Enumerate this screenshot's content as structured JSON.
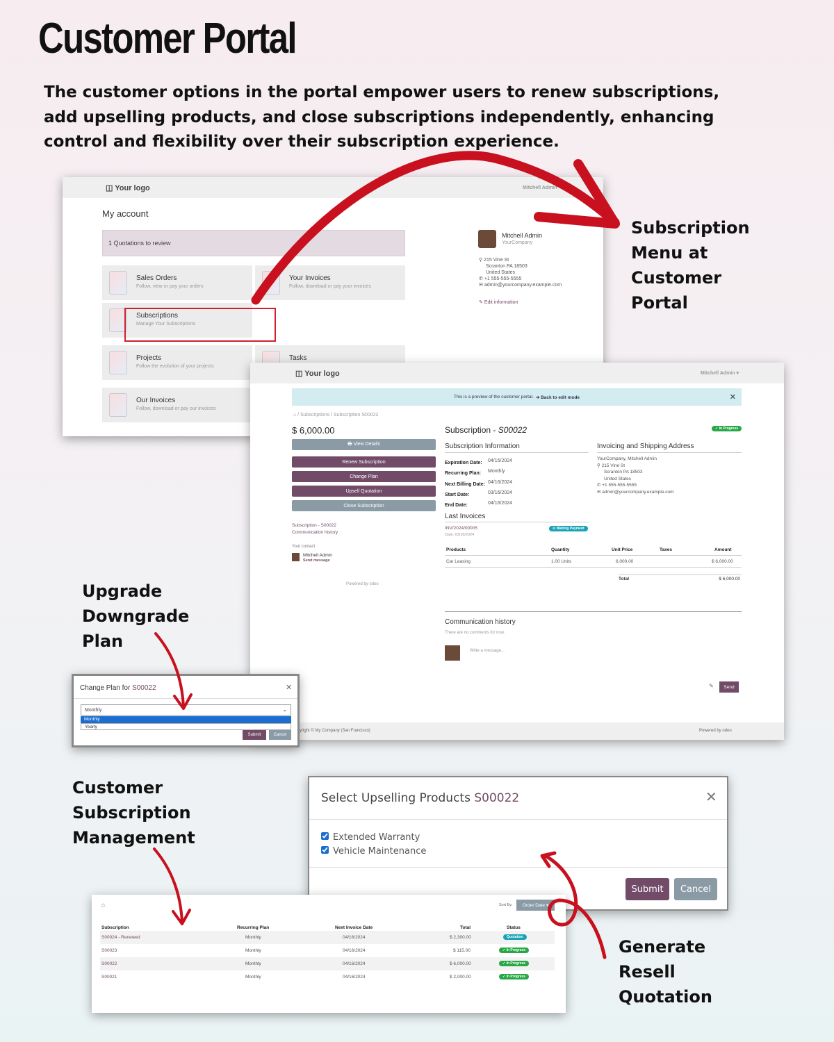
{
  "title": "Customer Portal",
  "intro": "The customer options in the portal empower users to renew subscriptions, add upselling products, and close subscriptions independently, enhancing control and flexibility over their subscription experience.",
  "callouts": {
    "menu": [
      "Subscription",
      "Menu at",
      "Customer",
      "Portal"
    ],
    "plan": [
      "Upgrade",
      "Downgrade",
      "Plan"
    ],
    "management": [
      "Customer",
      "Subscription",
      "Management"
    ],
    "resell": [
      "Generate",
      "Resell",
      "Quotation"
    ]
  },
  "colors": {
    "arrow": "#c8101e",
    "brand_purple": "#714b67",
    "badge_green": "#28a745",
    "badge_blue": "#17a2b8"
  },
  "myaccount": {
    "logo": "Your logo",
    "user_menu": "Mitchell Admin",
    "heading": "My account",
    "alert": "1 Quotations to review",
    "tiles": [
      {
        "title": "Sales Orders",
        "sub": "Follow, view or pay your orders"
      },
      {
        "title": "Your Invoices",
        "sub": "Follow, download or pay your invoices"
      },
      {
        "title": "Subscriptions",
        "sub": "Manage Your Subscriptions"
      },
      {
        "title": "Projects",
        "sub": "Follow the evolution of your projects"
      },
      {
        "title": "Tasks",
        "sub": ""
      },
      {
        "title": "Our Invoices",
        "sub": "Follow, download or pay our invoices"
      }
    ],
    "contact": {
      "name": "Mitchell Admin",
      "company": "YourCompany",
      "address1": "215 Vine St",
      "address2": "Scranton PA 18503",
      "address3": "United States",
      "phone": "+1 555-555-5555",
      "email": "admin@yourcompany.example.com",
      "edit": "Edit information"
    }
  },
  "subscription": {
    "logo": "Your logo",
    "user_menu": "Mitchell Admin ▾",
    "preview": "This is a preview of the customer portal.",
    "back_link": "➔ Back to edit mode",
    "breadcrumb": "⌂  /  Subscriptions  /  Subscription S00022",
    "amount": "$ 6,000.00",
    "buttons": {
      "view": "🖶 View Details",
      "renew": "Renew Subscription",
      "change": "Change Plan",
      "upsell": "Upsell Quotation",
      "close": "Close Subscription"
    },
    "side_links": [
      "Subscription - S00022",
      "Communication history"
    ],
    "your_contact": "Your contact",
    "contact_name": "Mitchell Admin",
    "send_message": "Send message",
    "powered": "Powered by odoo",
    "heading_prefix": "Subscription - ",
    "heading_ref": "S00022",
    "status": "✓ In Progress",
    "info_title": "Subscription Information",
    "info": [
      {
        "label": "Expiration Date:",
        "value": "04/15/2024"
      },
      {
        "label": "Recurring Plan:",
        "value": "Monthly"
      },
      {
        "label": "Next Billing Date:",
        "value": "04/16/2024"
      },
      {
        "label": "Start Date:",
        "value": "03/16/2024"
      },
      {
        "label": "End Date:",
        "value": "04/16/2024"
      }
    ],
    "address_title": "Invoicing and Shipping Address",
    "address": [
      "YourCompany, Mitchell Admin",
      "215 Vine St",
      "Scranton PA 18503",
      "United States",
      "+1 555-555-5555",
      "admin@yourcompany.example.com"
    ],
    "invoices_title": "Last Invoices",
    "invoice_ref": "INV/2024/00005",
    "invoice_date": "Date: 03/16/2024",
    "invoice_status": "⊙ Waiting Payment",
    "lines_header": [
      "Products",
      "Quantity",
      "Unit Price",
      "Taxes",
      "Amount"
    ],
    "lines": [
      {
        "product": "Car Leasing",
        "qty": "1.00 Units",
        "price": "6,000.00",
        "taxes": "",
        "amount": "$ 6,000.00"
      }
    ],
    "total_label": "Total",
    "total_value": "$ 6,000.00",
    "comm_title": "Communication history",
    "no_comments": "There are no comments for now.",
    "write": "Write a message...",
    "send": "Send",
    "copyright": "Copyright © My Company (San Francisco)",
    "footer_powered": "Powered by odoo"
  },
  "change_plan": {
    "title_prefix": "Change Plan for ",
    "ref": "S00022",
    "selected": "Monthly",
    "options": [
      "Monthly",
      "Yearly"
    ],
    "submit": "Submit",
    "cancel": "Cancel"
  },
  "upsell": {
    "title_prefix": "Select Upselling Products ",
    "ref": "S00022",
    "products": [
      {
        "name": "Extended Warranty",
        "checked": true
      },
      {
        "name": "Vehicle Maintenance",
        "checked": true
      }
    ],
    "submit": "Submit",
    "cancel": "Cancel"
  },
  "sub_list": {
    "sort_by": "Sort By:",
    "sort_value": "Order Date ▾",
    "headers": [
      "Subscription",
      "Recurring Plan",
      "Next Invoice Date",
      "Total",
      "Status"
    ],
    "rows": [
      {
        "ref": "S00024 - Renewed",
        "plan": "Monthly",
        "date": "04/16/2024",
        "total": "$ 2,300.00",
        "status": "Quotation"
      },
      {
        "ref": "S00023",
        "plan": "Monthly",
        "date": "04/16/2024",
        "total": "$ 115.00",
        "status": "✓ In Progress"
      },
      {
        "ref": "S00022",
        "plan": "Monthly",
        "date": "04/16/2024",
        "total": "$ 6,000.00",
        "status": "✓ In Progress"
      },
      {
        "ref": "S00021",
        "plan": "Monthly",
        "date": "04/16/2024",
        "total": "$ 2,000.00",
        "status": "✓ In Progress"
      }
    ]
  }
}
